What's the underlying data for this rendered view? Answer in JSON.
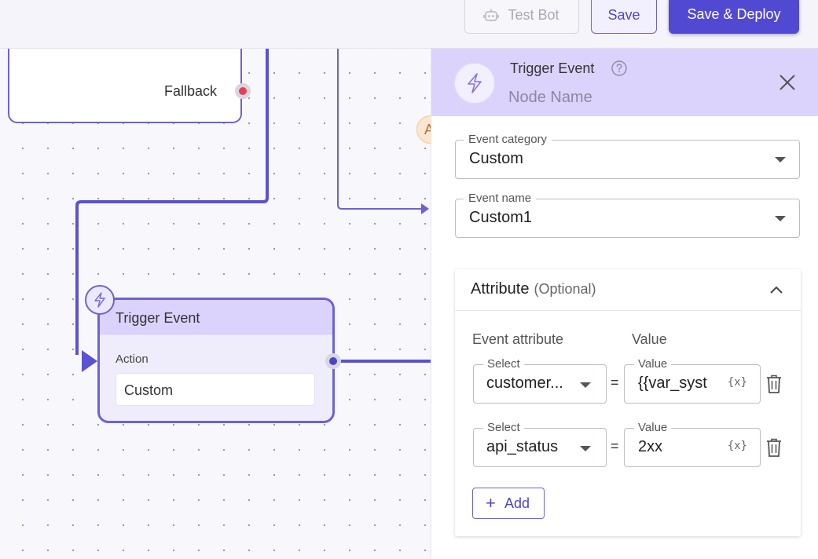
{
  "toolbar": {
    "test_bot_label": "Test Bot",
    "save_label": "Save",
    "save_deploy_label": "Save & Deploy"
  },
  "canvas": {
    "upper_node": {
      "fallback_label": "Fallback"
    },
    "trigger_node": {
      "title": "Trigger Event",
      "action_label": "Action",
      "action_value": "Custom"
    },
    "side_badge_letter": "A"
  },
  "panel": {
    "title": "Trigger Event",
    "node_name_placeholder": "Node Name",
    "event_category": {
      "label": "Event category",
      "value": "Custom"
    },
    "event_name": {
      "label": "Event name",
      "value": "Custom1"
    },
    "attribute": {
      "title": "Attribute",
      "optional_label": "(Optional)",
      "col_event_attribute": "Event attribute",
      "col_value": "Value",
      "rows": [
        {
          "select_label": "Select",
          "select_value": "customer...",
          "equals": "=",
          "value_label": "Value",
          "value": "{{var_syst",
          "var_icon": "{x}"
        },
        {
          "select_label": "Select",
          "select_value": "api_status",
          "equals": "=",
          "value_label": "Value",
          "value": "2xx",
          "var_icon": "{x}"
        }
      ],
      "add_label": "Add",
      "add_icon": "+"
    }
  },
  "colors": {
    "accent": "#5249d3",
    "node_border": "#6a63d6",
    "header_bg": "#dcd3fd",
    "fallback_dot": "#ee3b5b"
  }
}
